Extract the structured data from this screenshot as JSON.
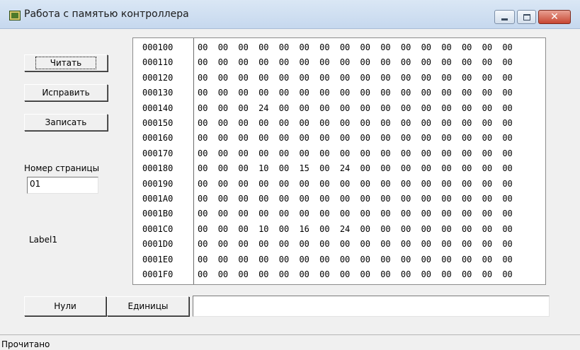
{
  "window": {
    "title": "Работа с памятью контроллера"
  },
  "buttons": {
    "read": "Читать",
    "fix": "Исправить",
    "write": "Записать",
    "zeros": "Нули",
    "ones": "Единицы"
  },
  "page_number": {
    "label": "Номер страницы",
    "value": "01"
  },
  "label1": "Label1",
  "bottom_input_value": "",
  "memory": [
    {
      "addr": "000100",
      "bytes": [
        "00",
        "00",
        "00",
        "00",
        "00",
        "00",
        "00",
        "00",
        "00",
        "00",
        "00",
        "00",
        "00",
        "00",
        "00",
        "00"
      ]
    },
    {
      "addr": "000110",
      "bytes": [
        "00",
        "00",
        "00",
        "00",
        "00",
        "00",
        "00",
        "00",
        "00",
        "00",
        "00",
        "00",
        "00",
        "00",
        "00",
        "00"
      ]
    },
    {
      "addr": "000120",
      "bytes": [
        "00",
        "00",
        "00",
        "00",
        "00",
        "00",
        "00",
        "00",
        "00",
        "00",
        "00",
        "00",
        "00",
        "00",
        "00",
        "00"
      ]
    },
    {
      "addr": "000130",
      "bytes": [
        "00",
        "00",
        "00",
        "00",
        "00",
        "00",
        "00",
        "00",
        "00",
        "00",
        "00",
        "00",
        "00",
        "00",
        "00",
        "00"
      ]
    },
    {
      "addr": "000140",
      "bytes": [
        "00",
        "00",
        "00",
        "24",
        "00",
        "00",
        "00",
        "00",
        "00",
        "00",
        "00",
        "00",
        "00",
        "00",
        "00",
        "00"
      ]
    },
    {
      "addr": "000150",
      "bytes": [
        "00",
        "00",
        "00",
        "00",
        "00",
        "00",
        "00",
        "00",
        "00",
        "00",
        "00",
        "00",
        "00",
        "00",
        "00",
        "00"
      ]
    },
    {
      "addr": "000160",
      "bytes": [
        "00",
        "00",
        "00",
        "00",
        "00",
        "00",
        "00",
        "00",
        "00",
        "00",
        "00",
        "00",
        "00",
        "00",
        "00",
        "00"
      ]
    },
    {
      "addr": "000170",
      "bytes": [
        "00",
        "00",
        "00",
        "00",
        "00",
        "00",
        "00",
        "00",
        "00",
        "00",
        "00",
        "00",
        "00",
        "00",
        "00",
        "00"
      ]
    },
    {
      "addr": "000180",
      "bytes": [
        "00",
        "00",
        "00",
        "10",
        "00",
        "15",
        "00",
        "24",
        "00",
        "00",
        "00",
        "00",
        "00",
        "00",
        "00",
        "00"
      ]
    },
    {
      "addr": "000190",
      "bytes": [
        "00",
        "00",
        "00",
        "00",
        "00",
        "00",
        "00",
        "00",
        "00",
        "00",
        "00",
        "00",
        "00",
        "00",
        "00",
        "00"
      ]
    },
    {
      "addr": "0001A0",
      "bytes": [
        "00",
        "00",
        "00",
        "00",
        "00",
        "00",
        "00",
        "00",
        "00",
        "00",
        "00",
        "00",
        "00",
        "00",
        "00",
        "00"
      ]
    },
    {
      "addr": "0001B0",
      "bytes": [
        "00",
        "00",
        "00",
        "00",
        "00",
        "00",
        "00",
        "00",
        "00",
        "00",
        "00",
        "00",
        "00",
        "00",
        "00",
        "00"
      ]
    },
    {
      "addr": "0001C0",
      "bytes": [
        "00",
        "00",
        "00",
        "10",
        "00",
        "16",
        "00",
        "24",
        "00",
        "00",
        "00",
        "00",
        "00",
        "00",
        "00",
        "00"
      ]
    },
    {
      "addr": "0001D0",
      "bytes": [
        "00",
        "00",
        "00",
        "00",
        "00",
        "00",
        "00",
        "00",
        "00",
        "00",
        "00",
        "00",
        "00",
        "00",
        "00",
        "00"
      ]
    },
    {
      "addr": "0001E0",
      "bytes": [
        "00",
        "00",
        "00",
        "00",
        "00",
        "00",
        "00",
        "00",
        "00",
        "00",
        "00",
        "00",
        "00",
        "00",
        "00",
        "00"
      ]
    },
    {
      "addr": "0001F0",
      "bytes": [
        "00",
        "00",
        "00",
        "00",
        "00",
        "00",
        "00",
        "00",
        "00",
        "00",
        "00",
        "00",
        "00",
        "00",
        "00",
        "00"
      ]
    }
  ],
  "statusbar": {
    "text": "Прочитано"
  }
}
